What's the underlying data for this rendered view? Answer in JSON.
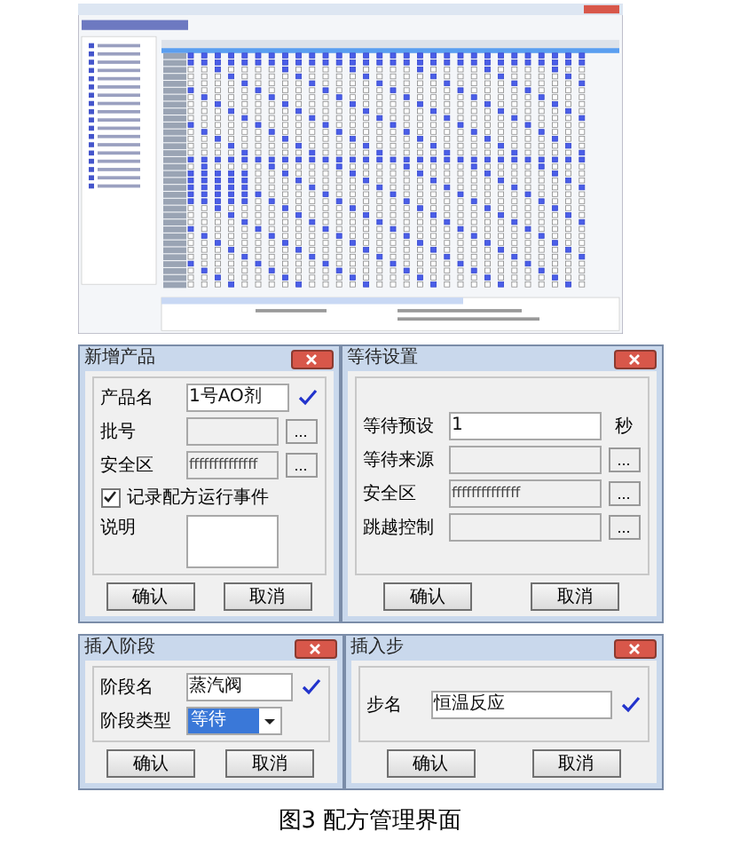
{
  "dialogs": [
    {
      "title": "新增产品",
      "fields": [
        {
          "kind": "text",
          "label": "产品名",
          "value": "1号AO剂",
          "disabled": false,
          "check": true
        },
        {
          "kind": "text",
          "label": "批号",
          "disabled": true,
          "browse": "..."
        },
        {
          "kind": "text",
          "label": "安全区",
          "value": "ffffffffffffff",
          "disabled": true,
          "browse": "..."
        },
        {
          "kind": "checkbox",
          "label": "记录配方运行事件",
          "checked": true
        },
        {
          "kind": "textarea",
          "label": "说明"
        }
      ],
      "buttons": [
        "确认",
        "取消"
      ]
    },
    {
      "title": "等待设置",
      "fields": [
        {
          "kind": "text",
          "label": "等待预设",
          "value": "1",
          "disabled": false,
          "unit": "秒"
        },
        {
          "kind": "text",
          "label": "等待来源",
          "disabled": true,
          "browse": "..."
        },
        {
          "kind": "text",
          "label": "安全区",
          "value": "ffffffffffffff",
          "disabled": true,
          "browse": "..."
        },
        {
          "kind": "text",
          "label": "跳越控制",
          "disabled": true,
          "browse": "..."
        }
      ],
      "buttons": [
        "确认",
        "取消"
      ]
    },
    {
      "title": "插入阶段",
      "fields": [
        {
          "kind": "text",
          "label": "阶段名",
          "value": "蒸汽阀",
          "disabled": false,
          "check": true
        },
        {
          "kind": "select",
          "label": "阶段类型",
          "value": "等待"
        }
      ],
      "buttons": [
        "确认",
        "取消"
      ]
    },
    {
      "title": "插入步",
      "fields": [
        {
          "kind": "text",
          "label": "步名",
          "value": "恒温反应",
          "disabled": false,
          "check": true
        }
      ],
      "buttons": [
        "确认",
        "取消"
      ]
    }
  ],
  "caption": "图3 配方管理界面"
}
